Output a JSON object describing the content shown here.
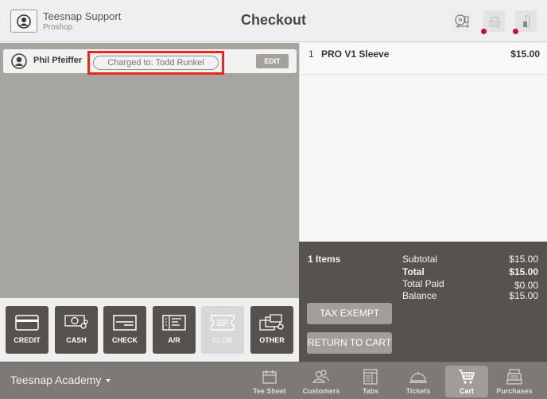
{
  "header": {
    "user_name": "Teesnap Support",
    "user_role": "Proshop",
    "title": "Checkout",
    "hardware": [
      {
        "icon": "card-reader-icon",
        "status": "connected"
      },
      {
        "icon": "receipt-printer-icon",
        "status": "disconnected",
        "status_color": "#c8102e"
      },
      {
        "icon": "cash-drawer-icon",
        "status": "disconnected",
        "status_color": "#c8102e"
      }
    ]
  },
  "customer": {
    "name": "Phil Pfeiffer",
    "charged_to": "Charged to: Todd Runkel",
    "edit_label": "EDIT",
    "highlight_color": "#e8291c"
  },
  "payment_methods": [
    {
      "label": "CREDIT",
      "icon": "credit-card-icon",
      "enabled": true
    },
    {
      "label": "CASH",
      "icon": "cash-icon",
      "enabled": true
    },
    {
      "label": "CHECK",
      "icon": "check-icon",
      "enabled": true
    },
    {
      "label": "A/R",
      "icon": "ledger-icon",
      "enabled": true
    },
    {
      "label": "CLUB",
      "icon": "club-ticket-icon",
      "enabled": false
    },
    {
      "label": "OTHER",
      "icon": "other-payment-icon",
      "enabled": true
    }
  ],
  "cart": {
    "items": [
      {
        "qty": "1",
        "name": "PRO V1 Sleeve",
        "price": "$15.00"
      }
    ]
  },
  "summary": {
    "items_count": "1 Items",
    "rows": [
      {
        "label": "Subtotal",
        "value": "$15.00",
        "bold": false
      },
      {
        "label": "Total",
        "value": "$15.00",
        "bold": true
      },
      {
        "label": "Total Paid",
        "value": "$0.00",
        "bold": false
      },
      {
        "label": "Balance",
        "value": "$15.00",
        "bold": false
      }
    ],
    "tax_exempt_label": "TAX EXEMPT",
    "return_label": "RETURN TO CART"
  },
  "bottom_nav": {
    "location": "Teesnap Academy",
    "items": [
      {
        "label": "Tee Sheet",
        "icon": "calendar-icon",
        "active": false
      },
      {
        "label": "Customers",
        "icon": "customers-icon",
        "active": false
      },
      {
        "label": "Tabs",
        "icon": "tabs-icon",
        "active": false
      },
      {
        "label": "Tickets",
        "icon": "service-bell-icon",
        "active": false
      },
      {
        "label": "Cart",
        "icon": "cart-icon",
        "active": true
      },
      {
        "label": "Purchases",
        "icon": "register-icon",
        "active": false
      }
    ]
  }
}
